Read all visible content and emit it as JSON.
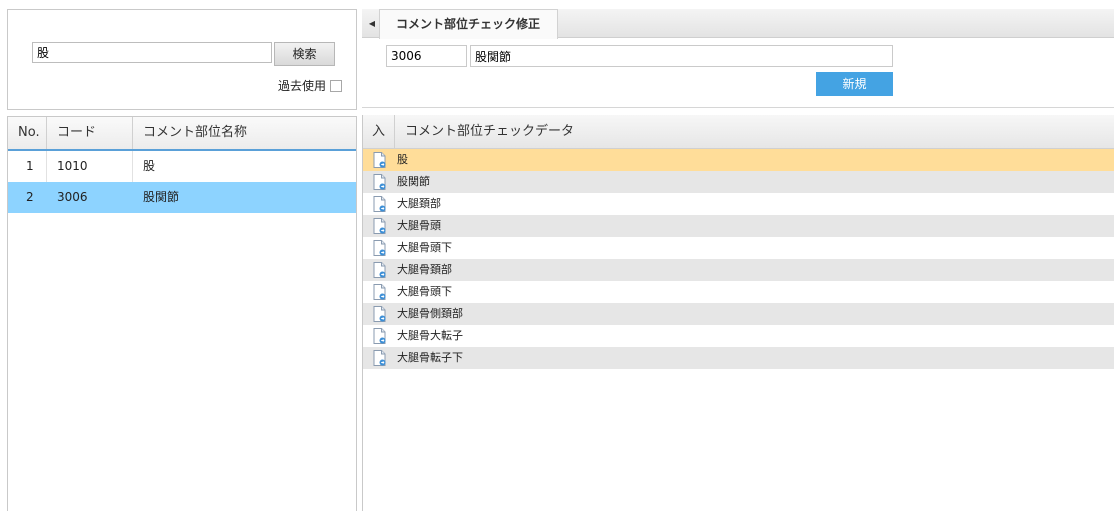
{
  "search": {
    "value": "股",
    "button_label": "検索",
    "past_use_label": "過去使用"
  },
  "list": {
    "headers": {
      "no": "No.",
      "code": "コード",
      "name": "コメント部位名称"
    },
    "rows": [
      {
        "no": "1",
        "code": "1010",
        "name": "股"
      },
      {
        "no": "2",
        "code": "3006",
        "name": "股関節"
      }
    ],
    "selected_index": 1
  },
  "tab": {
    "label": "コメント部位チェック修正"
  },
  "form": {
    "code": "3006",
    "name": "股関節",
    "new_button_label": "新規"
  },
  "data": {
    "headers": {
      "in": "入",
      "name": "コメント部位チェックデータ"
    },
    "rows": [
      "股",
      "股関節",
      "大腿頚部",
      "大腿骨頭",
      "大腿骨頭下",
      "大腿骨頚部",
      "大腿骨頭下",
      "大腿骨側頚部",
      "大腿骨大転子",
      "大腿骨転子下"
    ],
    "highlight_index": 0
  },
  "colors": {
    "selected_row": "#8dd3ff",
    "highlight_row": "#ffdd99",
    "accent_button": "#44a3e3"
  }
}
